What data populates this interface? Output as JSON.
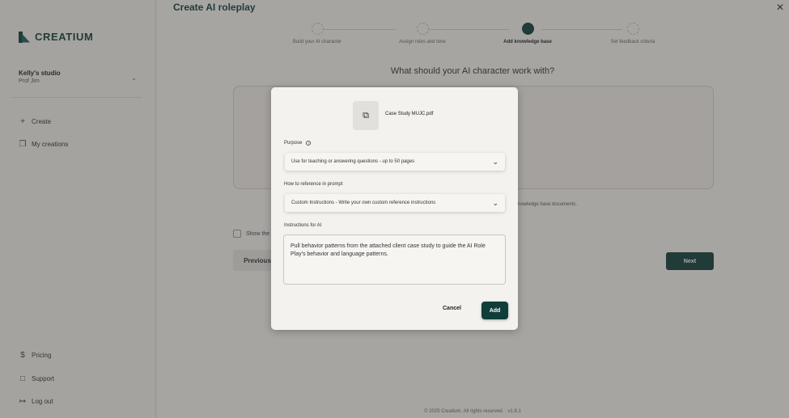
{
  "sidebar": {
    "logo_text": "CREATIUM",
    "studio_name": "Kelly's studio",
    "studio_subtitle": "Prof Jim",
    "nav": [
      {
        "label": "Create",
        "icon": "plus-icon"
      },
      {
        "label": "My creations",
        "icon": "stack-icon"
      }
    ],
    "bottom_nav": [
      {
        "label": "Pricing",
        "icon": "dollar-icon"
      },
      {
        "label": "Support",
        "icon": "chat-icon"
      },
      {
        "label": "Log out",
        "icon": "logout-icon"
      }
    ]
  },
  "main": {
    "title": "Create AI roleplay",
    "steps": [
      {
        "label": "Build your AI character",
        "active": false
      },
      {
        "label": "Assign roles and tone",
        "active": false
      },
      {
        "label": "Add knowledge base",
        "active": true
      },
      {
        "label": "Set feedback criteria",
        "active": false
      }
    ],
    "question": "What should your AI character work with?",
    "kb_hint": "nowledge base documents.",
    "show_label": "Show the",
    "previous_label": "Previous",
    "next_label": "Next",
    "footer": "© 2025 Creatium. All rights reserved. · v1.8.1"
  },
  "modal": {
    "file_name": "Case Study MUJC.pdf",
    "purpose_label": "Purpose",
    "purpose_value": "Use for teaching or answering questions - up to 50 pages",
    "reference_label": "How to reference in prompt",
    "reference_value": "Custom Instructions - Write your own custom reference instructions",
    "instructions_label": "Instructions for AI",
    "instructions_value": "Pull behavior patterns from the attached client case study to guide the AI Role Play's behavior and language patterns.",
    "cancel_label": "Cancel",
    "add_label": "Add"
  },
  "colors": {
    "brand": "#0f3d3a",
    "overlay": "rgba(60,58,55,0.42)"
  }
}
